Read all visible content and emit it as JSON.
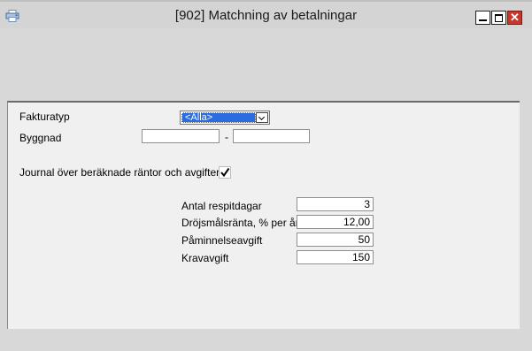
{
  "window": {
    "title": "[902]  Matchning av betalningar"
  },
  "titlebar_buttons": {
    "close_glyph": "✕"
  },
  "form": {
    "fakturatyp_label": "Fakturatyp",
    "fakturatyp_value": "<Alla>",
    "byggnad_label": "Byggnad",
    "byggnad_from": "",
    "byggnad_separator": "-",
    "byggnad_to": "",
    "journal_label": "Journal över beräknade räntor och avgifter",
    "journal_checked": true,
    "antal_respitdagar_label": "Antal respitdagar",
    "antal_respitdagar_value": "3",
    "drojsmalsranta_label": "Dröjsmålsränta, % per år",
    "drojsmalsranta_value": "12,00",
    "paminnelseavgift_label": "Påminnelseavgift",
    "paminnelseavgift_value": "50",
    "kravavgift_label": "Kravavgift",
    "kravavgift_value": "150"
  },
  "icons": {
    "app": "printer-icon",
    "minimize": "minimize-icon",
    "maximize": "maximize-icon",
    "close": "close-icon",
    "dropdown": "chevron-down-icon",
    "check": "check-icon"
  },
  "colors": {
    "close_button": "#c7382a",
    "selection": "#2b6de0"
  }
}
